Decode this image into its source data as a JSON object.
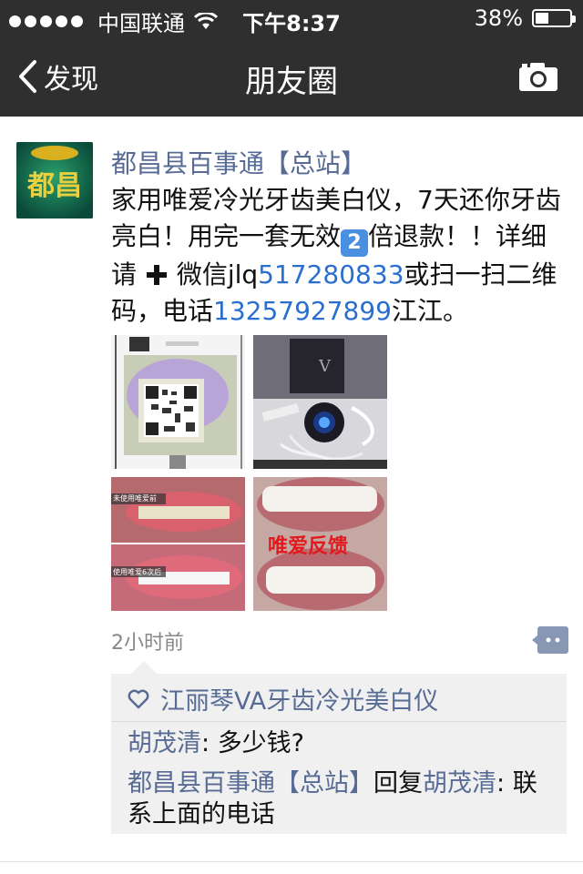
{
  "status": {
    "carrier": "中国联通",
    "time": "下午8:37",
    "battery": "38%",
    "battery_level": 0.38
  },
  "nav": {
    "back_label": "发现",
    "title": "朋友圈"
  },
  "post": {
    "author": "都昌县百事通【总站】",
    "avatar_text": "都昌",
    "text": {
      "part1": "家用唯爱冷光牙齿美白仪，7天还你牙齿亮白！用完一套无效",
      "emoji_num": "2",
      "part2": "倍退款！！详细请",
      "part3": "微信jlq",
      "wechat_id": "517280833",
      "part4": "或扫一扫二维码，电话",
      "phone": "13257927899",
      "part5": "江江。"
    },
    "photos": {
      "p3_label_top": "未使用唯爱前",
      "p3_label_bottom": "使用唯爱6次后",
      "p4_label": "唯爱反馈"
    },
    "time": "2小时前"
  },
  "comments": {
    "likes": "江丽琴VA牙齿冷光美白仪",
    "c1_name": "胡茂清",
    "c1_sep": ": ",
    "c1_text": "多少钱?",
    "c2_name": "都昌县百事通【总站】",
    "c2_reply": "回复",
    "c2_to": "胡茂清",
    "c2_sep": ": ",
    "c2_text": "联系上面的电话"
  },
  "colors": {
    "bar_bg": "#2f2f30",
    "name_blue": "#576b95",
    "link_blue": "#2a6fd0"
  }
}
